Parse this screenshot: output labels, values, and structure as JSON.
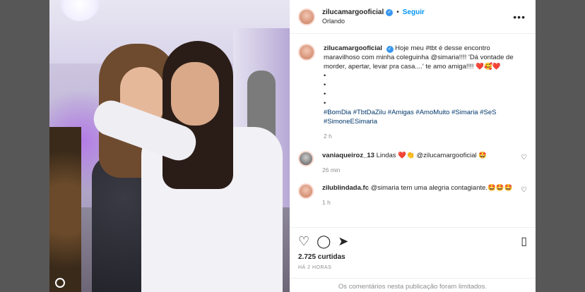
{
  "post": {
    "username": "zilucamargooficial",
    "follow_label": "Seguir",
    "location": "Orlando",
    "more_label": "•••"
  },
  "caption": {
    "username": "zilucamargooficial",
    "text": "Hoje meu #tbt é desse encontro maravilhoso com minha coleguinha @simaria!!!! 'Dá vontade de morder, apertar, levar pra casa....' te amo amiga!!!! ❤️🥰❤️",
    "bullets": [
      "•",
      "•",
      "•",
      "•"
    ],
    "hashtags": "#BomDia #TbtDaZilu #Amigas #AmoMuito #Simaria #SeS #SimoneESimaria",
    "time": "2 h"
  },
  "comments": [
    {
      "username": "vaniaqueiroz_13",
      "text": "Lindas ❤️👏 @zilucamargooficial 🤩",
      "time": "26 min"
    },
    {
      "username": "zilublindada.fc",
      "text": "@simaria tem uma alegria contagiante.🤩🤩🤩",
      "time": "1 h"
    }
  ],
  "actions": {
    "likes": "2.725 curtidas",
    "posted_ago": "HÁ 2 HORAS",
    "comments_limited": "Os comentários nesta publicação foram limitados."
  },
  "icons": {
    "like": "heart-icon",
    "comment": "comment-icon",
    "share": "share-icon",
    "save": "bookmark-icon"
  },
  "colors": {
    "link_blue": "#0095f6",
    "mention": "#00376b",
    "muted": "#8e8e8e",
    "backdrop": "#575757"
  }
}
